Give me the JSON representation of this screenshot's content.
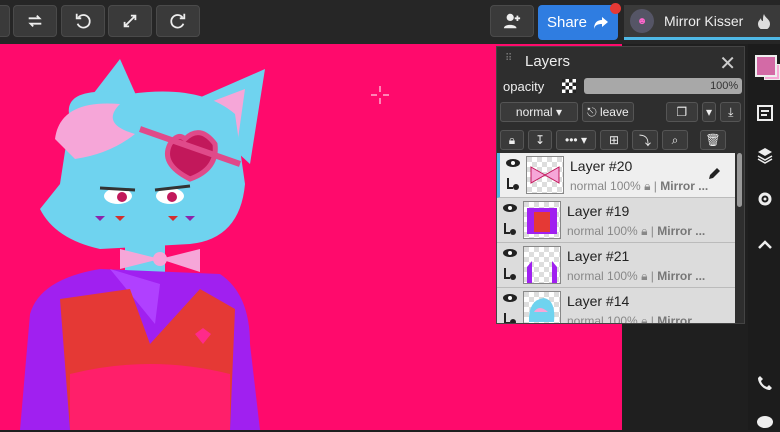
{
  "topbar": {
    "share_label": "Share",
    "user_name": "Mirror Kisser",
    "buttons": [
      "swap-icon",
      "undo-icon",
      "fullscreen-icon",
      "redo-icon"
    ]
  },
  "layers_panel": {
    "title": "Layers",
    "opacity_label": "opacity",
    "opacity_value": "100%",
    "blend_mode": "normal",
    "leave_label": "leave",
    "layers": [
      {
        "name": "Layer #20",
        "mode": "normal",
        "opacity": "100%",
        "owner": "Mirror ...",
        "selected": true
      },
      {
        "name": "Layer #19",
        "mode": "normal",
        "opacity": "100%",
        "owner": "Mirror ...",
        "selected": false
      },
      {
        "name": "Layer #21",
        "mode": "normal",
        "opacity": "100%",
        "owner": "Mirror ...",
        "selected": false
      },
      {
        "name": "Layer #14",
        "mode": "normal",
        "opacity": "100%",
        "owner": "Mirror ...",
        "selected": false
      }
    ]
  },
  "colors": {
    "canvas": "#ff0a6c",
    "primary_swatch": "#d36aa6",
    "secondary_swatch": "#f7a8d6",
    "accent": "#2f7de1"
  }
}
